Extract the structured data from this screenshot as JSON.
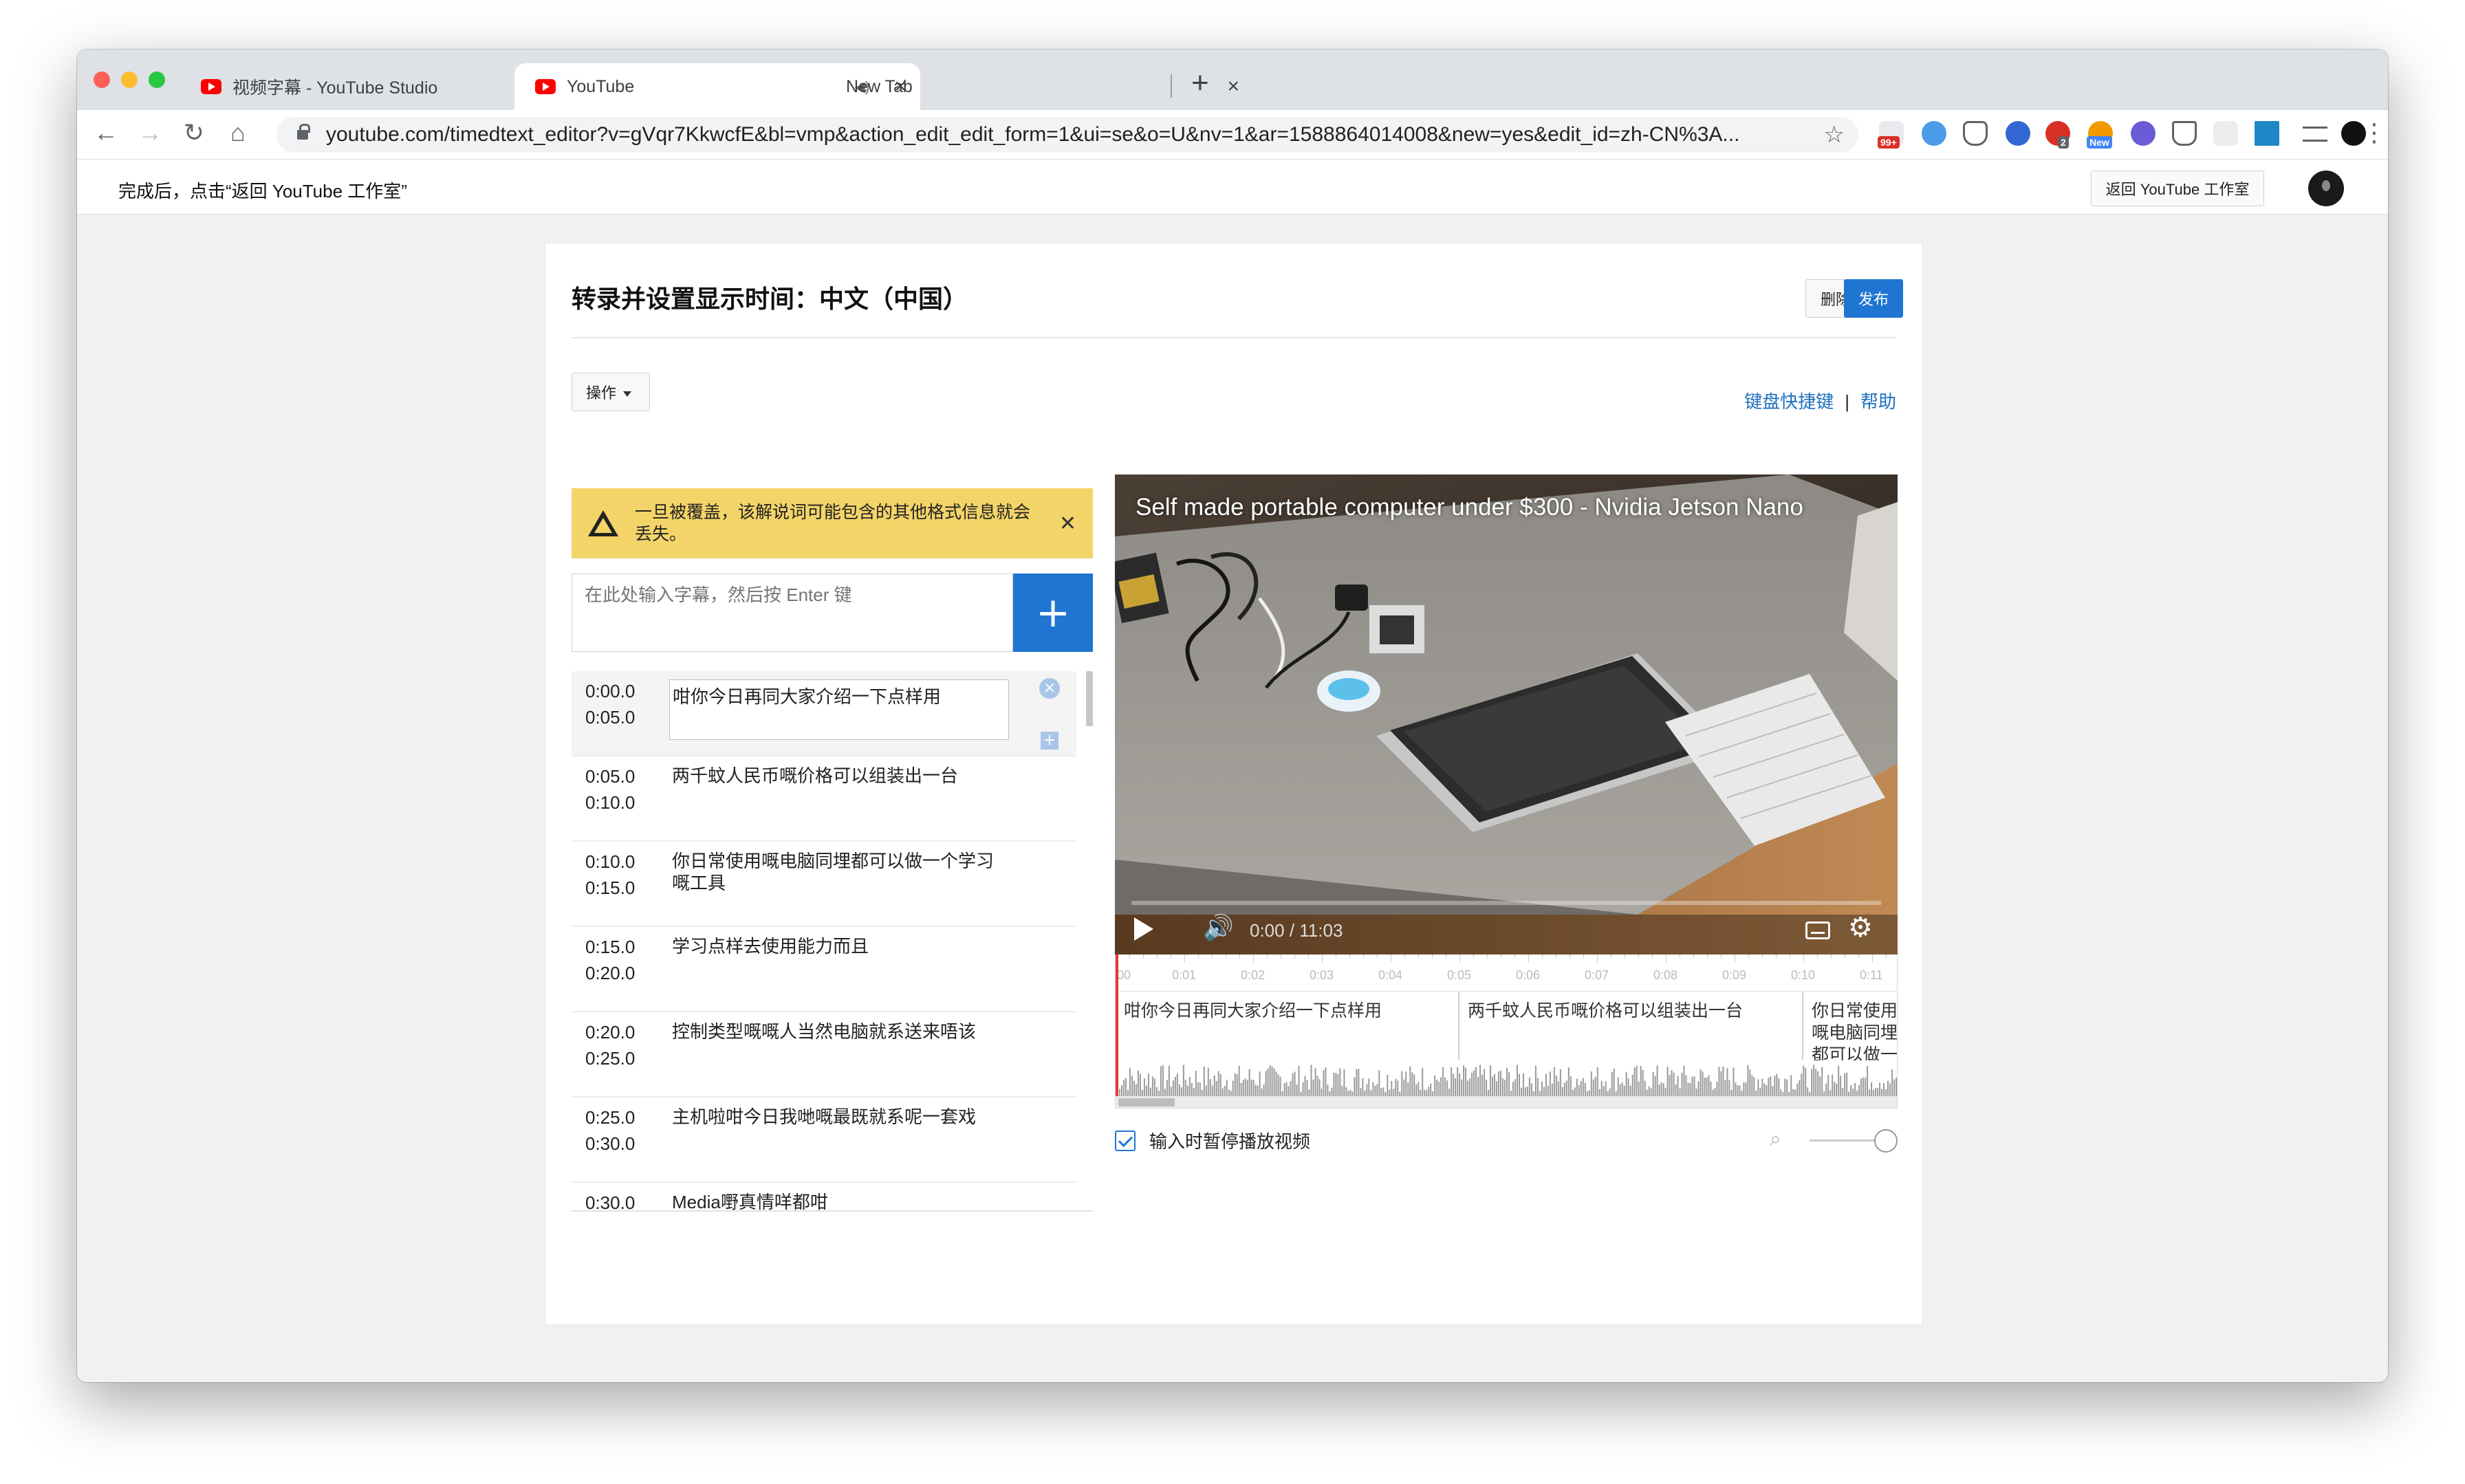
{
  "browser": {
    "tabs": [
      {
        "title": "视频字幕 - YouTube Studio"
      },
      {
        "title": "YouTube"
      },
      {
        "title": "New Tab"
      }
    ],
    "url": "youtube.com/timedtext_editor?v=gVqr7KkwcfE&bl=vmp&action_edit_edit_form=1&ui=se&o=U&nv=1&ar=1588864014008&new=yes&edit_id=zh-CN%3A...",
    "extension_badges": [
      "99+",
      "2",
      "New"
    ],
    "colors": {
      "tabstrip": "#dee1e6",
      "close": "#ff5f57",
      "minimize": "#febc2e",
      "zoom": "#28c840"
    }
  },
  "header": {
    "hint": "完成后，点击“返回 YouTube 工作室”",
    "return_button": "返回 YouTube 工作室"
  },
  "editor": {
    "title": "转录并设置显示时间：中文（中国）",
    "delete_draft": "删除草稿",
    "publish": "发布",
    "actions": "操作",
    "shortcuts": "键盘快捷键",
    "separator": "|",
    "help": "帮助",
    "warning": "一旦被覆盖，该解说词可能包含的其他格式信息就会丢失。",
    "input_placeholder": "在此处输入字幕，然后按 Enter 键",
    "add_icon": "+",
    "captions": [
      {
        "start": "0:00.0",
        "end": "0:05.0",
        "text": "咁你今日再同大家介绍一下点样用"
      },
      {
        "start": "0:05.0",
        "end": "0:10.0",
        "text": "两千蚊人民币嘅价格可以组装出一台"
      },
      {
        "start": "0:10.0",
        "end": "0:15.0",
        "text": "你日常使用嘅电脑同埋都可以做一个学习嘅工具"
      },
      {
        "start": "0:15.0",
        "end": "0:20.0",
        "text": "学习点样去使用能力而且"
      },
      {
        "start": "0:20.0",
        "end": "0:25.0",
        "text": "控制类型嘅嘅人当然电脑就系送来唔该"
      },
      {
        "start": "0:25.0",
        "end": "0:30.0",
        "text": "主机啦咁今日我哋嘅最既就系呢一套戏"
      },
      {
        "start": "0:30.0",
        "end": "",
        "text": "Media嘢真情咩都咁"
      }
    ]
  },
  "video": {
    "title": "Self made portable computer under $300 - Nvidia Jetson Nano",
    "time": "0:00 / 11:03",
    "progress": 0
  },
  "timeline": {
    "ticks": [
      "00",
      "0:01",
      "0:02",
      "0:03",
      "0:04",
      "0:05",
      "0:06",
      "0:07",
      "0:08",
      "0:09",
      "0:10",
      "0:11"
    ],
    "segments": [
      {
        "text": "咁你今日再同大家介绍一下点样用"
      },
      {
        "text": "两千蚊人民币嘅价格可以组装出一台"
      },
      {
        "text": "你日常使用嘅电脑同埋都可以做一个学习嘅工具"
      }
    ],
    "pause_label": "输入时暂停播放视频",
    "pause_checked": true,
    "zoom_level": 1
  }
}
